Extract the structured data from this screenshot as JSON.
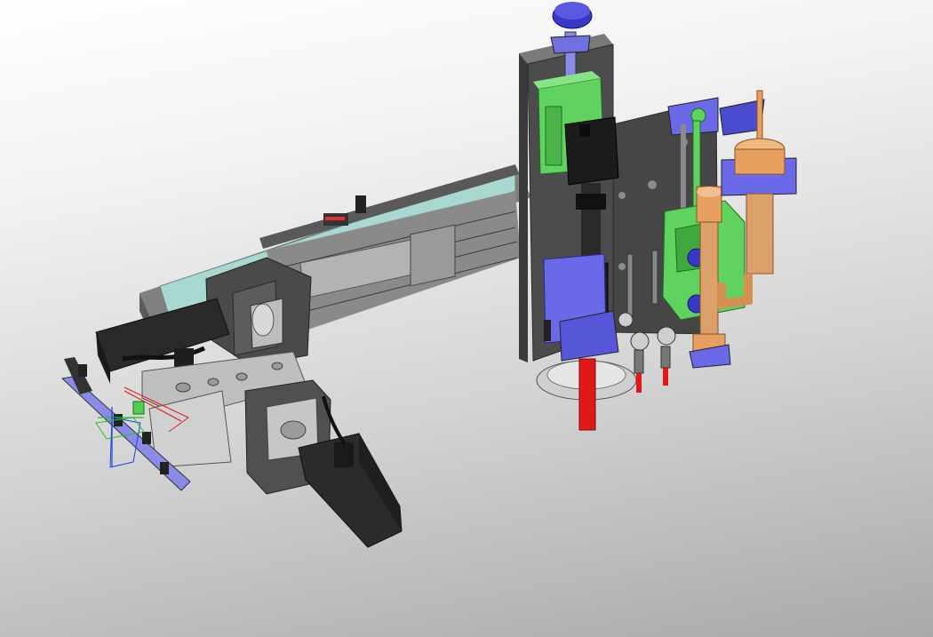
{
  "viewer": {
    "background": {
      "top": "#ffffff",
      "bottom": "#a6a6a6"
    },
    "model": {
      "kind": "3D CAD assembly",
      "palette": {
        "frame": "#4a4a4a",
        "frame_dark": "#2f2f2f",
        "frame_light": "#6a6a6a",
        "rail": "#9c9c9c",
        "cover": "#a8d8d0",
        "block_green": "#5fd25f",
        "bracket_blue": "#6a6ae8",
        "brass": "#e8a060",
        "red_pin": "#e01818",
        "motor": "#1e1e1e"
      }
    },
    "triad": {
      "axes": [
        "x",
        "y",
        "z"
      ],
      "colors": [
        "#e02020",
        "#20c020",
        "#2040e0"
      ]
    }
  }
}
